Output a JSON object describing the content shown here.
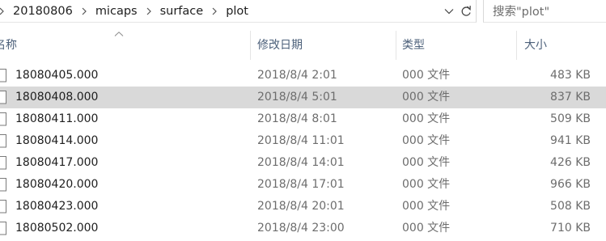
{
  "address_bar": {
    "breadcrumbs": [
      "20180806",
      "micaps",
      "surface",
      "plot"
    ]
  },
  "search": {
    "placeholder": "搜索\"plot\""
  },
  "columns": {
    "name": "名称",
    "date": "修改日期",
    "type": "类型",
    "size": "大小"
  },
  "files": [
    {
      "name": "18080405.000",
      "date": "2018/8/4 2:01",
      "type": "000 文件",
      "size": "483 KB"
    },
    {
      "name": "18080408.000",
      "date": "2018/8/4 5:01",
      "type": "000 文件",
      "size": "837 KB"
    },
    {
      "name": "18080411.000",
      "date": "2018/8/4 8:01",
      "type": "000 文件",
      "size": "509 KB"
    },
    {
      "name": "18080414.000",
      "date": "2018/8/4 11:01",
      "type": "000 文件",
      "size": "941 KB"
    },
    {
      "name": "18080417.000",
      "date": "2018/8/4 14:01",
      "type": "000 文件",
      "size": "426 KB"
    },
    {
      "name": "18080420.000",
      "date": "2018/8/4 17:01",
      "type": "000 文件",
      "size": "966 KB"
    },
    {
      "name": "18080423.000",
      "date": "2018/8/4 20:01",
      "type": "000 文件",
      "size": "508 KB"
    },
    {
      "name": "18080502.000",
      "date": "2018/8/4 23:00",
      "type": "000 文件",
      "size": "710 KB"
    }
  ],
  "selected_row_index": 1,
  "colors": {
    "selected_row": "#d9d9d9",
    "header_text": "#4c607a",
    "secondary_text": "#6d6d6d"
  },
  "icons": [
    "chevron-right-icon",
    "chevron-down-icon",
    "refresh-icon",
    "sort-up-icon",
    "file-icon"
  ]
}
